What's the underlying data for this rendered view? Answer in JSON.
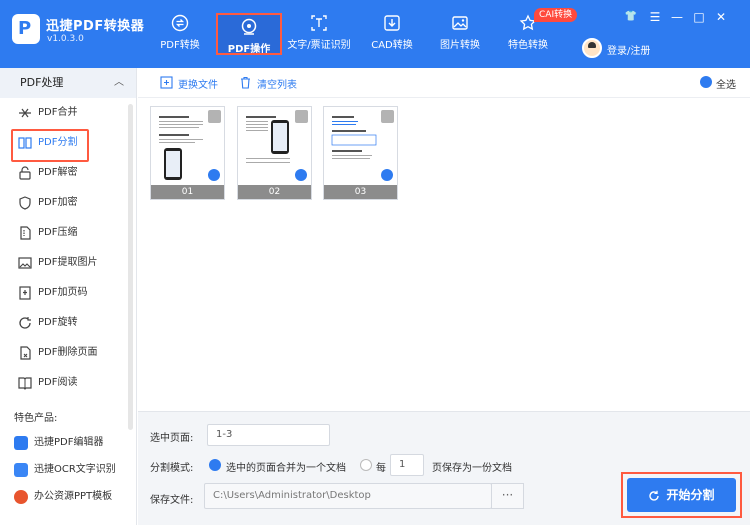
{
  "app": {
    "name": "迅捷PDF转换器",
    "version": "v1.0.3.0"
  },
  "nav": [
    {
      "label": "PDF转换",
      "icon": "exchange-icon"
    },
    {
      "label": "PDF操作",
      "icon": "pdf-ops-icon",
      "active": true
    },
    {
      "label": "文字/票证识别",
      "icon": "ocr-scan-icon"
    },
    {
      "label": "CAD转换",
      "icon": "cad-download-icon"
    },
    {
      "label": "图片转换",
      "icon": "image-icon"
    },
    {
      "label": "特色转换",
      "icon": "star-icon"
    }
  ],
  "cad_badge": "CAI转换",
  "user": {
    "login": "登录/注册"
  },
  "window_controls": {
    "skin": "👕",
    "menu": "☰",
    "min": "—",
    "max": "□",
    "close": "✕"
  },
  "sidebar": {
    "header": "PDF处理",
    "items": [
      {
        "label": "PDF合并",
        "icon": "merge-icon"
      },
      {
        "label": "PDF分割",
        "icon": "split-icon",
        "active": true
      },
      {
        "label": "PDF解密",
        "icon": "unlock-icon"
      },
      {
        "label": "PDF加密",
        "icon": "shield-icon"
      },
      {
        "label": "PDF压缩",
        "icon": "compress-icon"
      },
      {
        "label": "PDF提取图片",
        "icon": "extract-image-icon"
      },
      {
        "label": "PDF加页码",
        "icon": "page-number-icon"
      },
      {
        "label": "PDF旋转",
        "icon": "rotate-icon"
      },
      {
        "label": "PDF删除页面",
        "icon": "delete-page-icon"
      },
      {
        "label": "PDF阅读",
        "icon": "book-icon"
      }
    ],
    "featured_title": "特色产品:",
    "featured": [
      {
        "label": "迅捷PDF编辑器",
        "icon": "pdf-editor-icon"
      },
      {
        "label": "迅捷OCR文字识别",
        "icon": "ocr-app-icon"
      },
      {
        "label": "办公资源PPT模板",
        "icon": "ppt-template-icon"
      }
    ]
  },
  "toolbar": {
    "replace_file": "更换文件",
    "clear_list": "清空列表",
    "select_all": "全选"
  },
  "pages": [
    {
      "label": "01",
      "checked": true
    },
    {
      "label": "02",
      "checked": true
    },
    {
      "label": "03",
      "checked": true
    }
  ],
  "form": {
    "page_select_label": "选中页面:",
    "page_select_value": "1-3",
    "split_mode_label": "分割模式:",
    "mode_merge": "选中的页面合并为一个文档",
    "mode_every_prefix": "每",
    "mode_every_value": "1",
    "mode_every_suffix": "页保存为一份文档",
    "save_label": "保存文件:",
    "save_path": "C:\\Users\\Administrator\\Desktop",
    "browse": "···",
    "start": "开始分割"
  },
  "colors": {
    "brand": "#2e7bf0",
    "highlight": "#ff5a40"
  }
}
